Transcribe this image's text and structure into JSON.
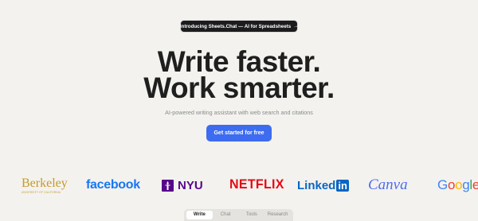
{
  "announcement": {
    "text": "Introducing Sheets.Chat — AI for Spreadsheets",
    "arrow": "→"
  },
  "hero": {
    "line1": "Write faster.",
    "line2": "Work smarter.",
    "subtitle": "AI-powered writing assistant with web search and citations",
    "cta_label": "Get started for free"
  },
  "logos": {
    "berkeley": {
      "word": "Berkeley",
      "sub": "UNIVERSITY OF CALIFORNIA"
    },
    "facebook": "facebook",
    "nyu": "NYU",
    "netflix": "NETFLIX",
    "linkedin": {
      "word": "Linked",
      "badge": "in"
    },
    "canva": "Canva",
    "google": [
      "G",
      "o",
      "o",
      "g",
      "l",
      "e"
    ]
  },
  "tabs": [
    "Write",
    "Chat",
    "Tools",
    "Research"
  ],
  "colors": {
    "accent": "#3d6cf0",
    "background": "#f3f2ef"
  }
}
